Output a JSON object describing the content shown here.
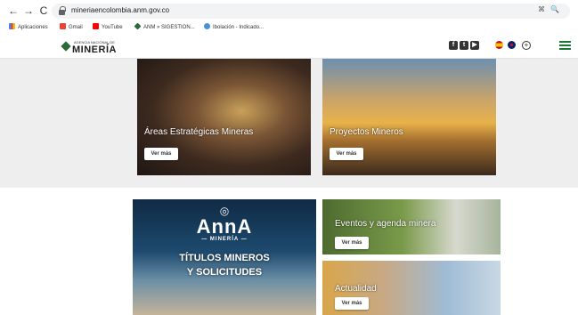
{
  "browser": {
    "url": "mineriaencolombia.anm.gov.co",
    "bookmarks": [
      "Aplicaciones",
      "Gmail",
      "YouTube",
      "ANM » SIGESTION...",
      "Ibolación - Indicado..."
    ]
  },
  "header": {
    "logo_small": "AGENCIA NACIONAL DE",
    "logo_big": "MINERÍA"
  },
  "cards": {
    "areas": {
      "title": "Áreas Estratégicas Mineras",
      "button": "Ver más"
    },
    "proyectos": {
      "title": "Proyectos Mineros",
      "button": "Ver más"
    },
    "anna": {
      "brand": "AnnA",
      "brand_sub": "— MINERÍA —",
      "line1": "TÍTULOS MINEROS",
      "line2": "Y SOLICITUDES"
    },
    "eventos": {
      "title": "Eventos y agenda minera",
      "button": "Ver más"
    },
    "actualidad": {
      "title": "Actualidad",
      "button": "Ver más"
    }
  },
  "colors": {
    "accent_green": "#1a7a35"
  }
}
